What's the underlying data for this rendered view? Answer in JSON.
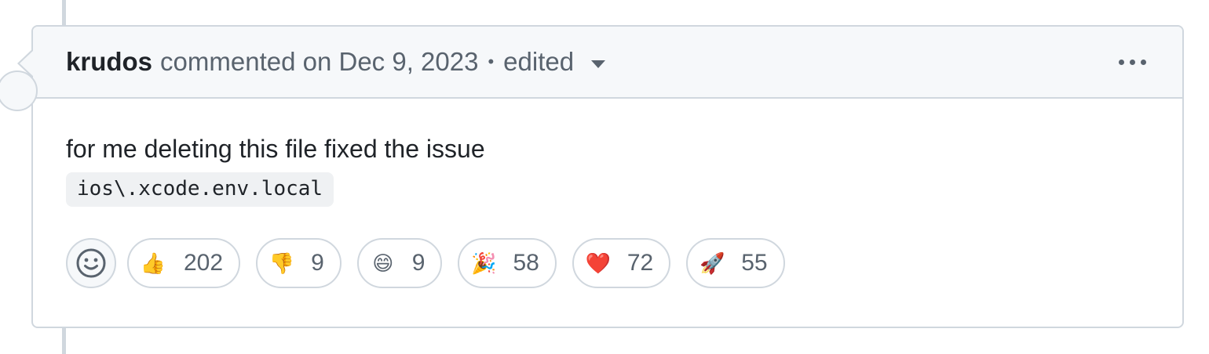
{
  "comment": {
    "author": "krudos",
    "meta": "commented on Dec 9, 2023",
    "separator": "•",
    "edited": "edited",
    "body_text": "for me deleting this file fixed the issue",
    "code": "ios\\.xcode.env.local"
  },
  "reactions": [
    {
      "name": "thumbs-up",
      "emoji": "👍",
      "count": "202"
    },
    {
      "name": "thumbs-down",
      "emoji": "👎",
      "count": "9"
    },
    {
      "name": "laugh",
      "emoji": "😄",
      "count": "9"
    },
    {
      "name": "hooray",
      "emoji": "🎉",
      "count": "58"
    },
    {
      "name": "heart",
      "emoji": "❤️",
      "count": "72"
    },
    {
      "name": "rocket",
      "emoji": "🚀",
      "count": "55"
    }
  ],
  "icons": {
    "add_reaction": "smiley-icon",
    "menu": "kebab-horizontal-icon",
    "edited_dropdown": "triangle-down-icon"
  },
  "colors": {
    "border": "#d0d7de",
    "header_bg": "#f6f8fa",
    "muted_text": "#59636e",
    "code_bg": "#eff1f3"
  }
}
